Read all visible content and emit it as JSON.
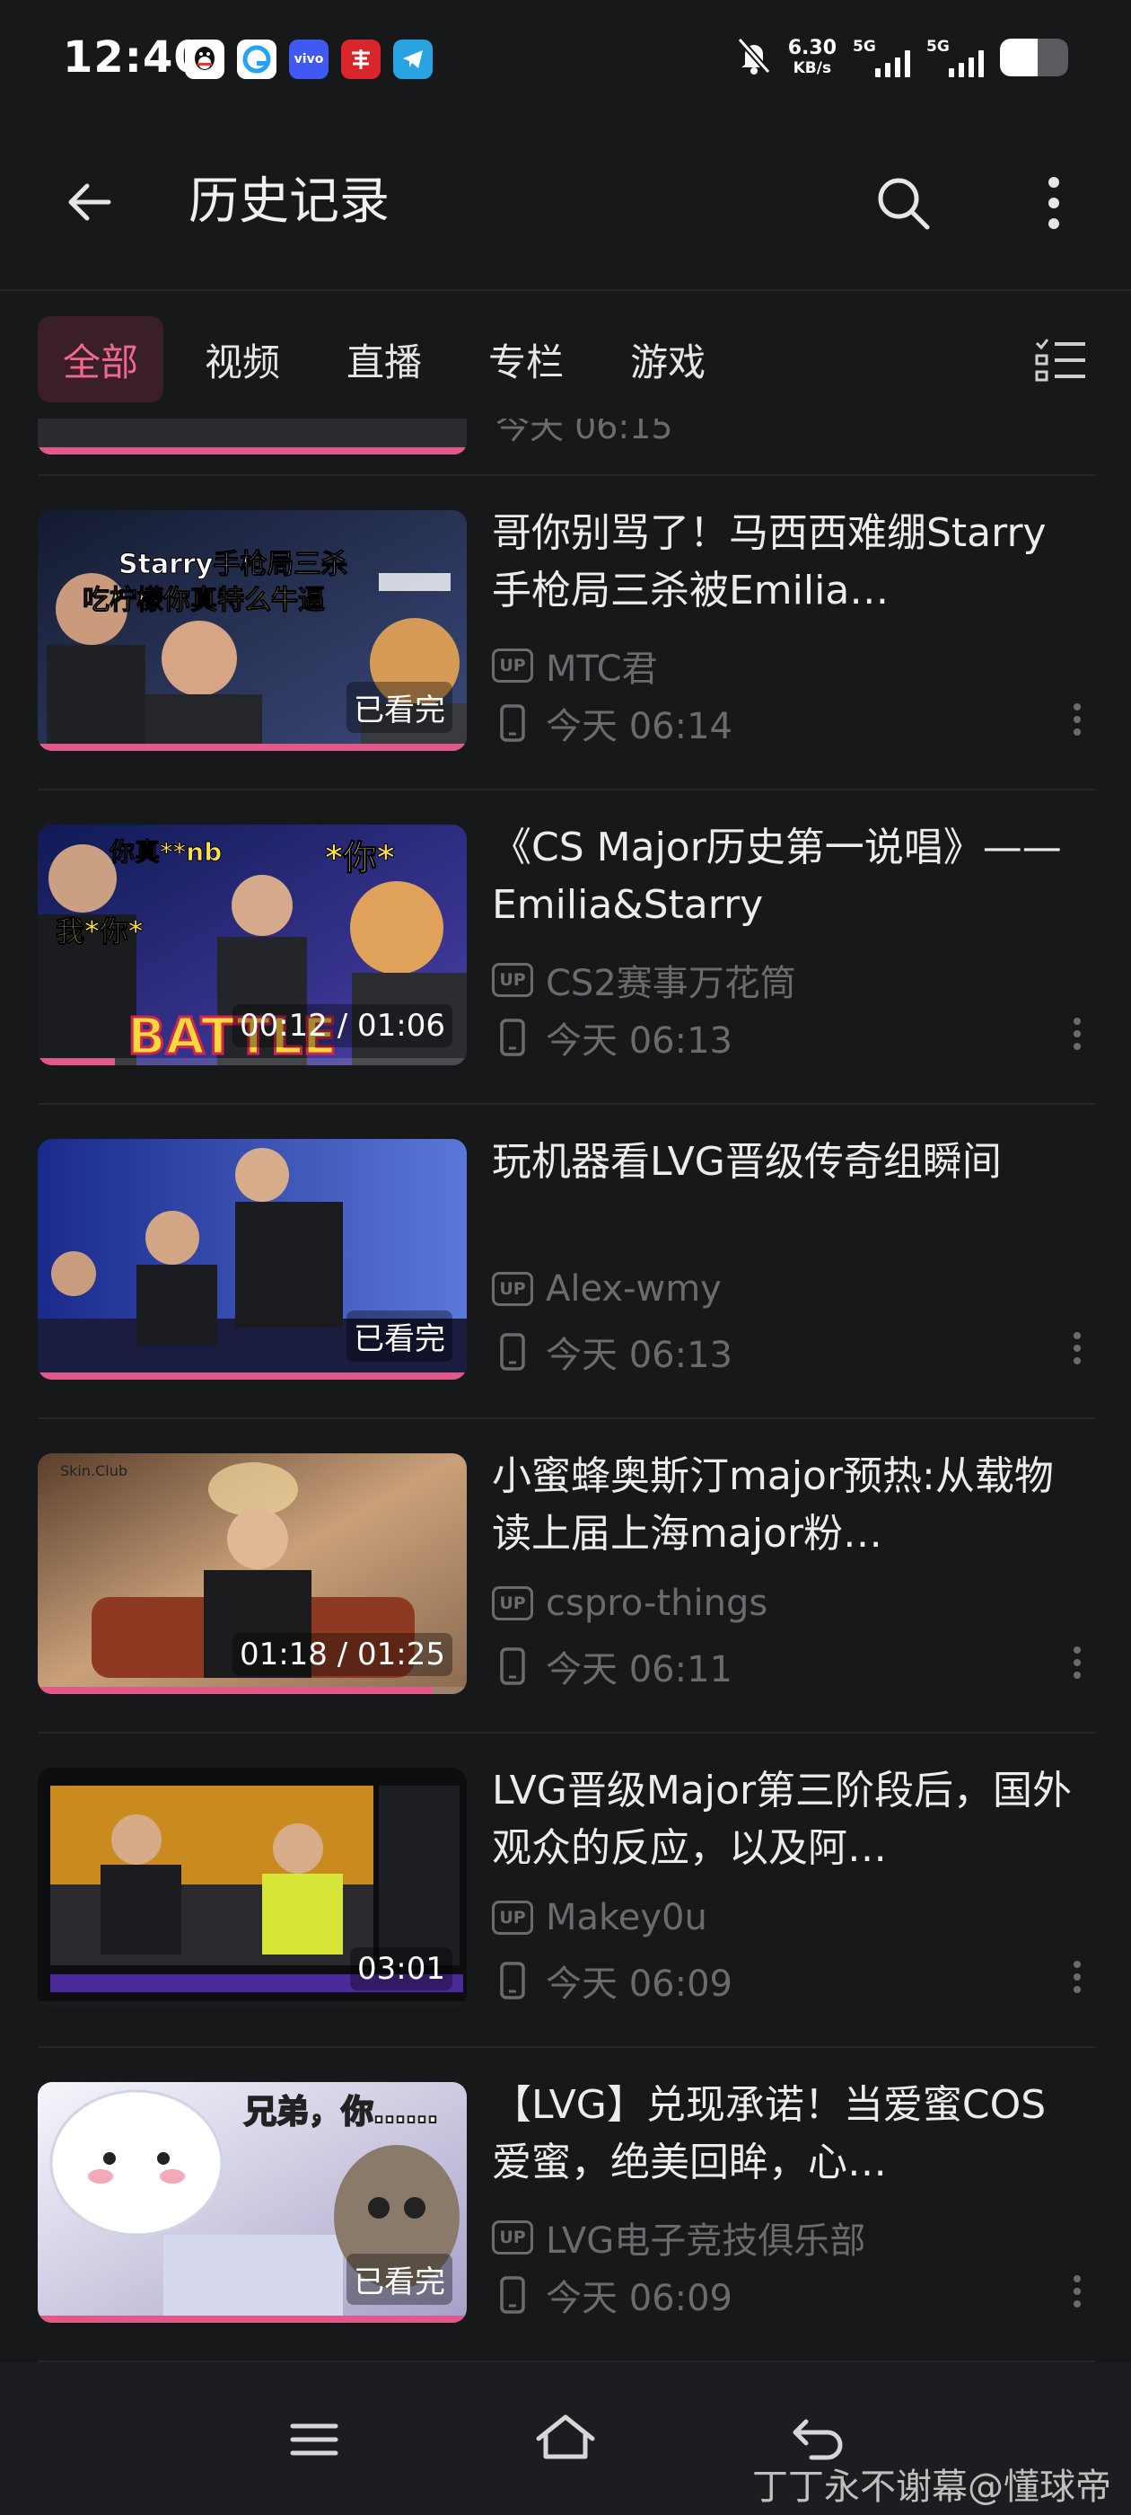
{
  "status_bar": {
    "time": "12:40",
    "notification_icons": [
      {
        "name": "qq-app-icon",
        "color": "#111111"
      },
      {
        "name": "browser-app-icon",
        "color": "#25a3f1"
      },
      {
        "name": "vivo-app-icon",
        "color": "#4159f2",
        "label": "vivo"
      },
      {
        "name": "news-app-icon",
        "color": "#d8262b"
      },
      {
        "name": "telegram-app-icon",
        "color": "#2aa3e3"
      }
    ],
    "mute_icon": "bell-off-icon",
    "net_speed_value": "6.30",
    "net_speed_unit": "KB/s",
    "signal1_label": "5G",
    "signal2_label": "5G",
    "battery_level": 0.55
  },
  "header": {
    "title": "历史记录",
    "back_icon": "arrow-left-icon",
    "search_icon": "search-icon",
    "more_icon": "more-vertical-icon"
  },
  "tabs": [
    {
      "label": "全部",
      "active": true
    },
    {
      "label": "视频",
      "active": false
    },
    {
      "label": "直播",
      "active": false
    },
    {
      "label": "专栏",
      "active": false
    },
    {
      "label": "游戏",
      "active": false
    }
  ],
  "filter_icon": "manage-list-icon",
  "partial_item": {
    "time": "今天 06:15"
  },
  "items": [
    {
      "title": "哥你别骂了！马西西难绷Starry手枪局三杀被Emilia…",
      "uploader": "MTC君",
      "up_badge": "UP",
      "time": "今天 06:14",
      "overlay": "已看完",
      "progress": 1.0,
      "thumb_caption_1": "Starry手枪局三杀",
      "thumb_caption_2": "吃柠檬你真特么牛逼",
      "thumb_colors": [
        "#1d2540",
        "#3b4a7a"
      ]
    },
    {
      "title": "《CS Major历史第一说唱》——Emilia&Starry",
      "uploader": "CS2赛事万花筒",
      "up_badge": "UP",
      "time": "今天 06:13",
      "overlay": "00:12 / 01:06",
      "progress": 0.18,
      "thumb_caption_1": "你真**nb",
      "thumb_caption_2": "*你*",
      "thumb_caption_3": "我*你*",
      "thumb_caption_4": "BATTLE",
      "thumb_colors": [
        "#1c2a6b",
        "#3d46a8"
      ]
    },
    {
      "title": "玩机器看LVG晋级传奇组瞬间",
      "uploader": "Alex-wmy",
      "up_badge": "UP",
      "time": "今天 06:13",
      "overlay": "已看完",
      "progress": 1.0,
      "thumb_colors": [
        "#1d2f8c",
        "#3b58c9"
      ]
    },
    {
      "title": "小蜜蜂奥斯汀major预热:从载物读上届上海major粉…",
      "uploader": "cspro-things",
      "up_badge": "UP",
      "time": "今天 06:11",
      "overlay": "01:18 / 01:25",
      "progress": 0.92,
      "thumb_caption_1": "Skin.Club",
      "thumb_colors": [
        "#6b4a34",
        "#c9a07a"
      ]
    },
    {
      "title": "LVG晋级Major第三阶段后，国外观众的反应，以及阿…",
      "uploader": "Makey0u",
      "up_badge": "UP",
      "time": "今天 06:09",
      "overlay": "03:01",
      "progress": 0.0,
      "thumb_colors": [
        "#111111",
        "#c98a1e"
      ]
    },
    {
      "title": "【LVG】兑现承诺！当爱蜜COS爱蜜，绝美回眸，心…",
      "uploader": "LVG电子竞技俱乐部",
      "up_badge": "UP",
      "time": "今天 06:09",
      "overlay": "已看完",
      "progress": 1.0,
      "thumb_caption_1": "兄弟，你……",
      "thumb_colors": [
        "#e9ecf5",
        "#a6a0c8"
      ]
    }
  ],
  "bottom_nav": {
    "menu_icon": "menu-icon",
    "home_icon": "home-icon",
    "back_icon": "back-gesture-icon"
  },
  "watermark": "丁丁永不谢幕@懂球帝",
  "colors": {
    "background": "#17181a",
    "accent": "#f0678f",
    "progress": "#e1588b",
    "muted_text": "#6a6b6f"
  }
}
